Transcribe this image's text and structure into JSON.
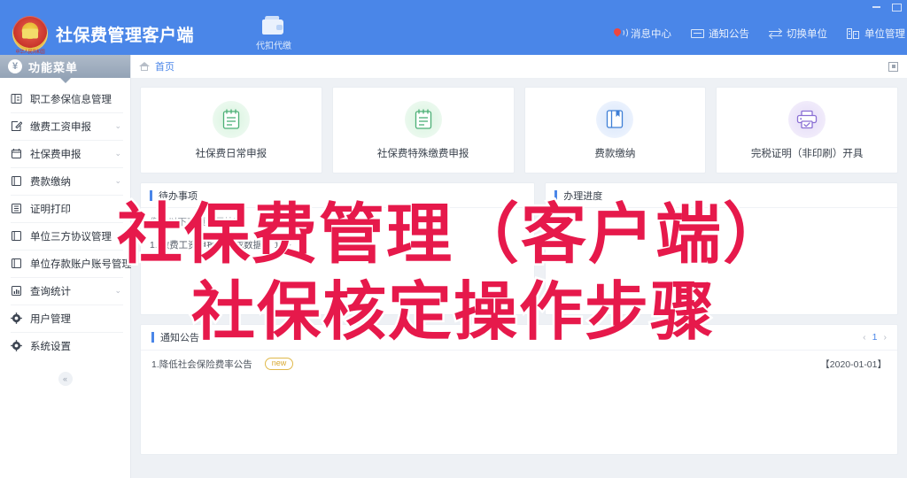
{
  "window": {
    "minimize_icon": "minimize-icon",
    "restore_icon": "restore-icon"
  },
  "header": {
    "emblem_icon": "national-emblem-icon",
    "emblem_caption": "中华人民共和国",
    "app_title": "社保费管理客户端",
    "tool": {
      "icon": "wallet-icon",
      "label": "代扣代缴"
    },
    "right_items": [
      {
        "icon": "message-icon",
        "label": "消息中心"
      },
      {
        "icon": "envelope-icon",
        "label": "通知公告"
      },
      {
        "icon": "swap-icon",
        "label": "切换单位"
      },
      {
        "icon": "building-icon",
        "label": "单位管理"
      }
    ]
  },
  "sidebar": {
    "head": {
      "icon": "menu-circle-icon",
      "label": "功能菜单"
    },
    "collapse_icon": "collapse-left-icon",
    "items": [
      {
        "icon": "employee-info-icon",
        "label": "职工参保信息管理",
        "has_arrow": false
      },
      {
        "icon": "edit-icon",
        "label": "缴费工资申报",
        "has_arrow": true,
        "arrow": "⌄"
      },
      {
        "icon": "clipboard-icon",
        "label": "社保费申报",
        "has_arrow": true,
        "arrow": "⌄"
      },
      {
        "icon": "book-icon",
        "label": "费款缴纳",
        "has_arrow": true,
        "arrow": "⌄"
      },
      {
        "icon": "print-icon",
        "label": "证明打印",
        "has_arrow": false
      },
      {
        "icon": "agreement-icon",
        "label": "单位三方协议管理",
        "has_arrow": false
      },
      {
        "icon": "account-icon",
        "label": "单位存款账户账号管理",
        "has_arrow": false
      },
      {
        "icon": "chart-icon",
        "label": "查询统计",
        "has_arrow": true,
        "arrow": "⌄"
      },
      {
        "icon": "gear-icon",
        "label": "用户管理",
        "has_arrow": false
      },
      {
        "icon": "gear-icon",
        "label": "系统设置",
        "has_arrow": false
      }
    ]
  },
  "breadcrumb": {
    "home_icon": "home-icon",
    "current": "首页",
    "right_icon": "fullscreen-icon"
  },
  "cards": [
    {
      "icon": "declaration-icon",
      "color_class": "green",
      "label": "社保费日常申报"
    },
    {
      "icon": "special-declaration-icon",
      "color_class": "green",
      "label": "社保费特殊缴费申报"
    },
    {
      "icon": "payment-icon",
      "color_class": "blue",
      "label": "费款缴纳"
    },
    {
      "icon": "tax-certificate-icon",
      "color_class": "purple",
      "label": "完税证明（非印刷）开具"
    }
  ],
  "panels": [
    {
      "title": "待办事项",
      "subtitle": "您有以下事项需要处理",
      "rows": [
        "1. 缴费工资申报未完成数据有 1 条"
      ]
    },
    {
      "title": "办理进度",
      "subtitle": "",
      "rows": []
    }
  ],
  "notice": {
    "title": "通知公告",
    "pager": {
      "prev": "‹",
      "page": "1",
      "next": "›"
    },
    "rows": [
      {
        "text": "1.降低社会保险费率公告",
        "badge": "new",
        "date": "【2020-01-01】"
      }
    ]
  },
  "overlay": {
    "line1": "社保费管理（客户端）",
    "line2": "社保核定操作步骤",
    "color": "#e6194b",
    "stroke": "#ffffff"
  }
}
